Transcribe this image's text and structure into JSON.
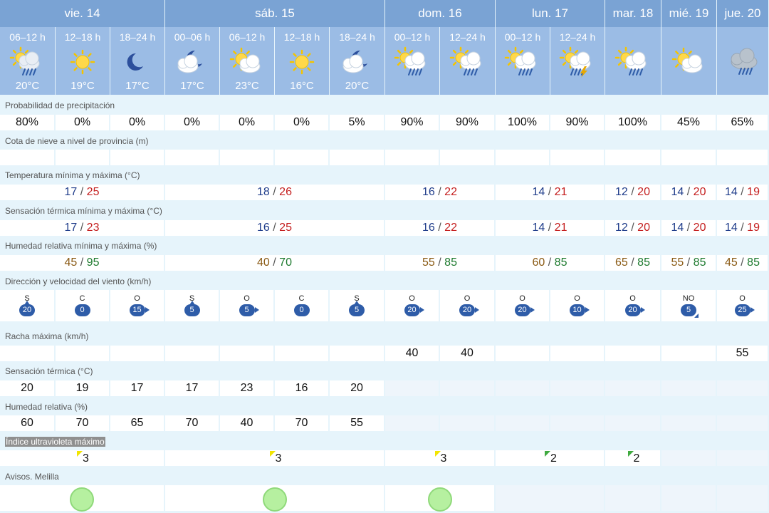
{
  "days": [
    {
      "label": "vie. 14"
    },
    {
      "label": "sáb. 15"
    },
    {
      "label": "dom. 16"
    },
    {
      "label": "lun. 17"
    },
    {
      "label": "mar. 18"
    },
    {
      "label": "mié. 19"
    },
    {
      "label": "jue. 20"
    }
  ],
  "slots": [
    {
      "period": "06–12 h",
      "temp": "20°C",
      "icon": "cloud-rain-sun-icon"
    },
    {
      "period": "12–18 h",
      "temp": "19°C",
      "icon": "sun-icon"
    },
    {
      "period": "18–24 h",
      "temp": "17°C",
      "icon": "moon-icon"
    },
    {
      "period": "00–06 h",
      "temp": "17°C",
      "icon": "moon-cloud-icon"
    },
    {
      "period": "06–12 h",
      "temp": "23°C",
      "icon": "sun-cloud-icon"
    },
    {
      "period": "12–18 h",
      "temp": "16°C",
      "icon": "sun-icon"
    },
    {
      "period": "18–24 h",
      "temp": "20°C",
      "icon": "moon-cloud-icon"
    },
    {
      "period": "00–12 h",
      "temp": "",
      "icon": "sun-cloud-rain-icon"
    },
    {
      "period": "12–24 h",
      "temp": "",
      "icon": "sun-cloud-rain-icon"
    },
    {
      "period": "00–12 h",
      "temp": "",
      "icon": "sun-cloud-rain-icon"
    },
    {
      "period": "12–24 h",
      "temp": "",
      "icon": "sun-storm-icon"
    },
    {
      "period": "",
      "temp": "",
      "icon": "sun-cloud-rain-icon"
    },
    {
      "period": "",
      "temp": "",
      "icon": "sun-cloud-icon"
    },
    {
      "period": "",
      "temp": "",
      "icon": "cloud-rain-icon"
    }
  ],
  "sections": {
    "precip": "Probabilidad de precipitación",
    "snow": "Cota de nieve a nivel de provincia (m)",
    "temp": "Temperatura mínima y máxima (°C)",
    "feels": "Sensación térmica mínima y máxima (°C)",
    "hum": "Humedad relativa mínima y máxima (%)",
    "wind": "Dirección y velocidad del viento (km/h)",
    "gust": "Racha máxima (km/h)",
    "feels_slot": "Sensación térmica (°C)",
    "hum_slot": "Humedad relativa (%)",
    "uv": "Índice ultravioleta máximo",
    "alerts": "Avisos. Melilla"
  },
  "precip": [
    "80%",
    "0%",
    "0%",
    "0%",
    "0%",
    "0%",
    "5%",
    "90%",
    "90%",
    "100%",
    "90%",
    "100%",
    "45%",
    "65%"
  ],
  "temp_minmax": [
    {
      "min": "17",
      "max": "25"
    },
    {
      "min": "18",
      "max": "26"
    },
    {
      "min": "16",
      "max": "22"
    },
    {
      "min": "14",
      "max": "21"
    },
    {
      "min": "12",
      "max": "20"
    },
    {
      "min": "14",
      "max": "20"
    },
    {
      "min": "14",
      "max": "19"
    }
  ],
  "feels_minmax": [
    {
      "min": "17",
      "max": "23"
    },
    {
      "min": "16",
      "max": "25"
    },
    {
      "min": "16",
      "max": "22"
    },
    {
      "min": "14",
      "max": "21"
    },
    {
      "min": "12",
      "max": "20"
    },
    {
      "min": "14",
      "max": "20"
    },
    {
      "min": "14",
      "max": "19"
    }
  ],
  "hum_minmax": [
    {
      "min": "45",
      "max": "95"
    },
    {
      "min": "40",
      "max": "70"
    },
    {
      "min": "55",
      "max": "85"
    },
    {
      "min": "60",
      "max": "85"
    },
    {
      "min": "65",
      "max": "85"
    },
    {
      "min": "55",
      "max": "85"
    },
    {
      "min": "45",
      "max": "85"
    }
  ],
  "slash": "/",
  "wind": [
    {
      "dir": "S",
      "speed": "20",
      "arrow": "up"
    },
    {
      "dir": "C",
      "speed": "0",
      "arrow": "none"
    },
    {
      "dir": "O",
      "speed": "15",
      "arrow": "right"
    },
    {
      "dir": "S",
      "speed": "5",
      "arrow": "up"
    },
    {
      "dir": "O",
      "speed": "5",
      "arrow": "right"
    },
    {
      "dir": "C",
      "speed": "0",
      "arrow": "none"
    },
    {
      "dir": "S",
      "speed": "5",
      "arrow": "up"
    },
    {
      "dir": "O",
      "speed": "20",
      "arrow": "right"
    },
    {
      "dir": "O",
      "speed": "20",
      "arrow": "right"
    },
    {
      "dir": "O",
      "speed": "20",
      "arrow": "right"
    },
    {
      "dir": "O",
      "speed": "10",
      "arrow": "right"
    },
    {
      "dir": "O",
      "speed": "20",
      "arrow": "right"
    },
    {
      "dir": "NO",
      "speed": "5",
      "arrow": "down-right"
    },
    {
      "dir": "O",
      "speed": "25",
      "arrow": "right"
    }
  ],
  "gust": [
    "",
    "",
    "",
    "",
    "",
    "",
    "",
    "40",
    "40",
    "",
    "",
    "",
    "",
    "55"
  ],
  "feels_slot": [
    "20",
    "19",
    "17",
    "17",
    "23",
    "16",
    "20"
  ],
  "hum_slot": [
    "60",
    "70",
    "65",
    "70",
    "40",
    "70",
    "55"
  ],
  "uv": [
    {
      "value": "3",
      "color": "#f2e500"
    },
    {
      "value": "3",
      "color": "#f2e500"
    },
    {
      "value": "3",
      "color": "#f2e500"
    },
    {
      "value": "2",
      "color": "#3faa3f"
    },
    {
      "value": "2",
      "color": "#3faa3f"
    }
  ],
  "colors": {
    "header": "#7aa3d4",
    "slot": "#9bbce5",
    "alert_green": "#b6f0a0"
  }
}
